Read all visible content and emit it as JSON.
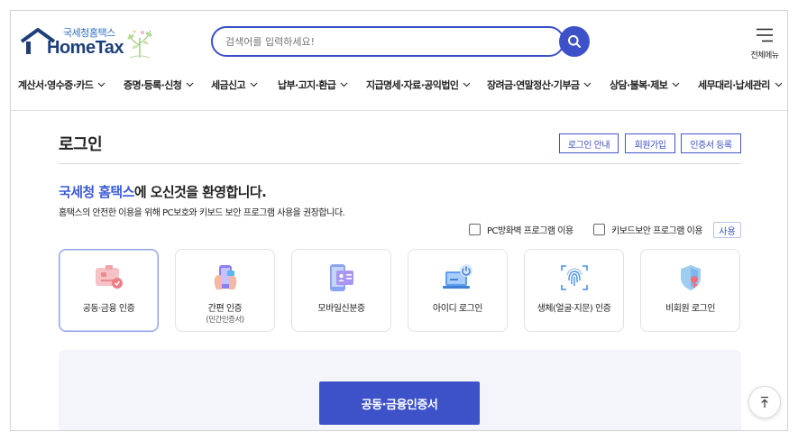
{
  "logo": {
    "sub": "국세청홈택스",
    "main": "HomeTax"
  },
  "search": {
    "placeholder": "검색어를 입력하세요!"
  },
  "allmenu": {
    "label": "전체메뉴"
  },
  "gnb": [
    {
      "label": "계산서·영수증·카드"
    },
    {
      "label": "증명·등록·신청"
    },
    {
      "label": "세금신고"
    },
    {
      "label": "납부·고지·환급"
    },
    {
      "label": "지급명세·자료·공익법인"
    },
    {
      "label": "장려금·연말정산·기부금"
    },
    {
      "label": "상담·불복·제보"
    },
    {
      "label": "세무대리·납세관리"
    }
  ],
  "page": {
    "title": "로그인"
  },
  "top_buttons": [
    {
      "label": "로그인 안내"
    },
    {
      "label": "회원가입"
    },
    {
      "label": "인증서 등록"
    }
  ],
  "welcome": {
    "highlight": "국세청 홈택스",
    "rest": "에 오신것을 환영합니다."
  },
  "desc": "홈택스의 안전한 이용을 위해 PC보호와 키보드 보안 프로그램 사용을 권장합니다.",
  "options": {
    "pc_firewall": "PC방화벽 프로그램 이용",
    "keyboard_security": "키보드보안 프로그램 이용",
    "use_label": "사용"
  },
  "cards": [
    {
      "label": "공동·금융 인증",
      "sub": "",
      "icon": "certificate-card-icon",
      "active": true
    },
    {
      "label": "간편 인증",
      "sub": "(민간인증서)",
      "icon": "phone-hand-icon",
      "active": false
    },
    {
      "label": "모바일신분증",
      "sub": "",
      "icon": "mobile-id-icon",
      "active": false
    },
    {
      "label": "아이디 로그인",
      "sub": "",
      "icon": "laptop-power-icon",
      "active": false
    },
    {
      "label": "생체(얼굴·지문) 인증",
      "sub": "",
      "icon": "fingerprint-icon",
      "active": false
    },
    {
      "label": "비회원 로그인",
      "sub": "",
      "icon": "shield-key-icon",
      "active": false
    }
  ],
  "main_button": {
    "label": "공동·금융인증서"
  },
  "colors": {
    "primary": "#3d52c8",
    "highlight": "#3b5bd6",
    "panel": "#f3f5fb"
  }
}
